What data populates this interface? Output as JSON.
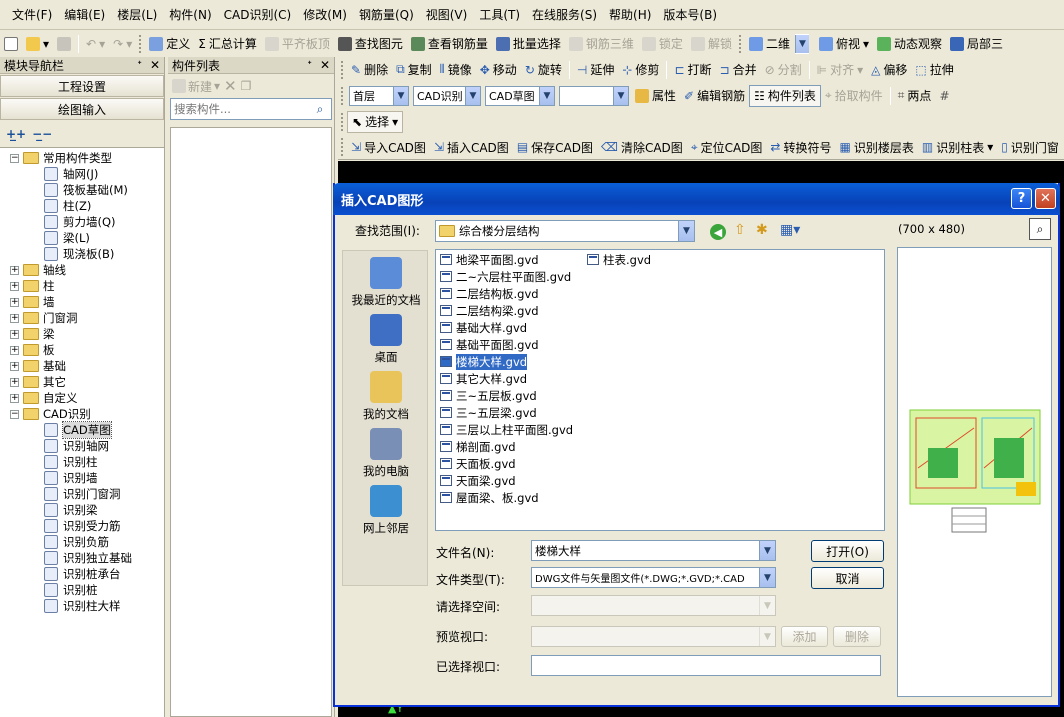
{
  "menubar": [
    "文件(F)",
    "编辑(E)",
    "楼层(L)",
    "构件(N)",
    "CAD识别(C)",
    "修改(M)",
    "钢筋量(Q)",
    "视图(V)",
    "工具(T)",
    "在线服务(S)",
    "帮助(H)",
    "版本号(B)"
  ],
  "toolbar1": {
    "define": "定义",
    "sum_calc": "汇总计算",
    "flush_top": "平齐板顶",
    "find_element": "查找图元",
    "view_rebar": "查看钢筋量",
    "batch_select": "批量选择",
    "rebar_3d": "钢筋三维",
    "lock": "锁定",
    "unlock": "解锁",
    "view_mode": "二维",
    "top_view": "俯视",
    "dynamic_view": "动态观察",
    "local_3d": "局部三"
  },
  "toolbar2": {
    "delete": "删除",
    "copy": "复制",
    "mirror": "镜像",
    "move": "移动",
    "rotate": "旋转",
    "extend": "延伸",
    "trim": "修剪",
    "break": "打断",
    "merge": "合并",
    "split": "分割",
    "align": "对齐",
    "offset": "偏移",
    "stretch": "拉伸"
  },
  "toolbar3": {
    "floor": "首层",
    "cad_recog": "CAD识别",
    "cad_sketch": "CAD草图",
    "blank_combo": "",
    "properties": "属性",
    "edit_rebar": "编辑钢筋",
    "component_list": "构件列表",
    "pick_component": "拾取构件",
    "two_points": "两点"
  },
  "toolbar4": {
    "select": "选择"
  },
  "toolbar5": {
    "import_cad": "导入CAD图",
    "insert_cad": "插入CAD图",
    "save_cad": "保存CAD图",
    "clear_cad": "清除CAD图",
    "locate_cad": "定位CAD图",
    "convert_symbol": "转换符号",
    "recog_floor_table": "识别楼层表",
    "recog_column_table": "识别柱表",
    "recog_door": "识别门窗"
  },
  "nav_panel": {
    "title": "模块导航栏",
    "project_settings": "工程设置",
    "drawing_input": "绘图输入",
    "tree": [
      {
        "label": "常用构件类型",
        "level": 0,
        "type": "folder",
        "expanded": true
      },
      {
        "label": "轴网(J)",
        "level": 1,
        "type": "leaf"
      },
      {
        "label": "筏板基础(M)",
        "level": 1,
        "type": "leaf"
      },
      {
        "label": "柱(Z)",
        "level": 1,
        "type": "leaf"
      },
      {
        "label": "剪力墙(Q)",
        "level": 1,
        "type": "leaf"
      },
      {
        "label": "梁(L)",
        "level": 1,
        "type": "leaf"
      },
      {
        "label": "现浇板(B)",
        "level": 1,
        "type": "leaf"
      },
      {
        "label": "轴线",
        "level": 0,
        "type": "folder",
        "expanded": false
      },
      {
        "label": "柱",
        "level": 0,
        "type": "folder",
        "expanded": false
      },
      {
        "label": "墙",
        "level": 0,
        "type": "folder",
        "expanded": false
      },
      {
        "label": "门窗洞",
        "level": 0,
        "type": "folder",
        "expanded": false
      },
      {
        "label": "梁",
        "level": 0,
        "type": "folder",
        "expanded": false
      },
      {
        "label": "板",
        "level": 0,
        "type": "folder",
        "expanded": false
      },
      {
        "label": "基础",
        "level": 0,
        "type": "folder",
        "expanded": false
      },
      {
        "label": "其它",
        "level": 0,
        "type": "folder",
        "expanded": false
      },
      {
        "label": "自定义",
        "level": 0,
        "type": "folder",
        "expanded": false
      },
      {
        "label": "CAD识别",
        "level": 0,
        "type": "folder",
        "expanded": true
      },
      {
        "label": "CAD草图",
        "level": 1,
        "type": "leaf",
        "selected": true
      },
      {
        "label": "识别轴网",
        "level": 1,
        "type": "leaf"
      },
      {
        "label": "识别柱",
        "level": 1,
        "type": "leaf"
      },
      {
        "label": "识别墙",
        "level": 1,
        "type": "leaf"
      },
      {
        "label": "识别门窗洞",
        "level": 1,
        "type": "leaf"
      },
      {
        "label": "识别梁",
        "level": 1,
        "type": "leaf"
      },
      {
        "label": "识别受力筋",
        "level": 1,
        "type": "leaf"
      },
      {
        "label": "识别负筋",
        "level": 1,
        "type": "leaf"
      },
      {
        "label": "识别独立基础",
        "level": 1,
        "type": "leaf"
      },
      {
        "label": "识别桩承台",
        "level": 1,
        "type": "leaf"
      },
      {
        "label": "识别桩",
        "level": 1,
        "type": "leaf"
      },
      {
        "label": "识别柱大样",
        "level": 1,
        "type": "leaf"
      }
    ]
  },
  "component_panel": {
    "title": "构件列表",
    "new_label": "新建",
    "search_placeholder": "搜索构件..."
  },
  "dialog": {
    "title": "插入CAD图形",
    "look_in_label": "查找范围(I):",
    "look_in_value": "综合楼分层结构",
    "preview_size": "(700 x 480)",
    "places": [
      "我最近的文档",
      "桌面",
      "我的文档",
      "我的电脑",
      "网上邻居"
    ],
    "files_col1": [
      "地梁平面图.gvd",
      "二~六层柱平面图.gvd",
      "二层结构板.gvd",
      "二层结构梁.gvd",
      "基础大样.gvd",
      "基础平面图.gvd",
      "楼梯大样.gvd",
      "其它大样.gvd",
      "三~五层板.gvd",
      "三~五层梁.gvd",
      "三层以上柱平面图.gvd",
      "梯剖面.gvd",
      "天面板.gvd",
      "天面梁.gvd",
      "屋面梁、板.gvd"
    ],
    "files_col2": [
      "柱表.gvd"
    ],
    "selected_file": "楼梯大样.gvd",
    "filename_label": "文件名(N):",
    "filename_value": "楼梯大样",
    "filetype_label": "文件类型(T):",
    "filetype_value": "DWG文件与矢量图文件(*.DWG;*.GVD;*.CAD",
    "space_label": "请选择空间:",
    "preview_vp_label": "预览视口:",
    "selected_vp_label": "已选择视口:",
    "open_button": "打开(O)",
    "cancel_button": "取消",
    "add_button": "添加",
    "delete_button": "删除"
  },
  "colors": {
    "title_bar": "#0842b8",
    "selection": "#316ac5",
    "window_bg": "#ece9d8",
    "canvas": "#000000"
  }
}
